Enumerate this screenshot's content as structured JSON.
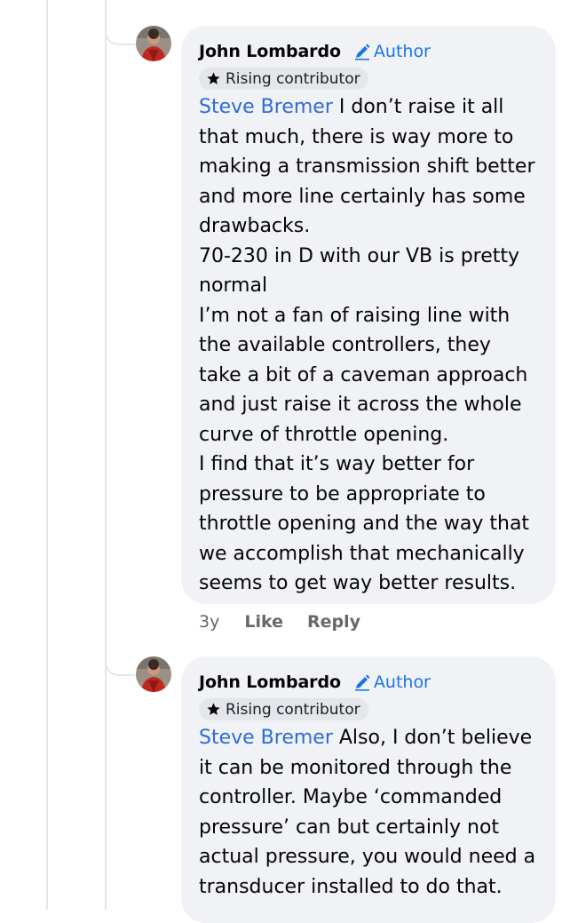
{
  "comments": [
    {
      "author": "John Lombardo",
      "author_badge": "Author",
      "contributor_badge": "Rising contributor",
      "mention": "Steve Bremer",
      "text": " I don’t raise it all that much, there is way more to making a transmission shift better and more line certainly has some drawbacks.\n70-230 in D with our VB is pretty normal\nI’m not a fan of raising line with the available controllers, they take a bit of a caveman approach and just raise it across the whole curve of throttle opening.\nI find that it’s way better for pressure to be appropriate to throttle opening and the way that we accomplish that mechanically seems to get way better results.",
      "time": "3y",
      "like_label": "Like",
      "reply_label": "Reply"
    },
    {
      "author": "John Lombardo",
      "author_badge": "Author",
      "contributor_badge": "Rising contributor",
      "mention": "Steve Bremer",
      "text": " Also, I don’t believe it can be monitored through the controller. Maybe ‘commanded pressure’ can but certainly not actual pressure, you would need a transducer installed to do that."
    }
  ],
  "colors": {
    "bubble": "#f0f2f5",
    "mention": "#2e6bd6",
    "author_badge": "#1b74e4",
    "meta_text": "#65676b",
    "thread_line": "#e4e6ea"
  },
  "icons": {
    "author_badge": "pencil-icon",
    "contributor_badge": "star-icon"
  }
}
